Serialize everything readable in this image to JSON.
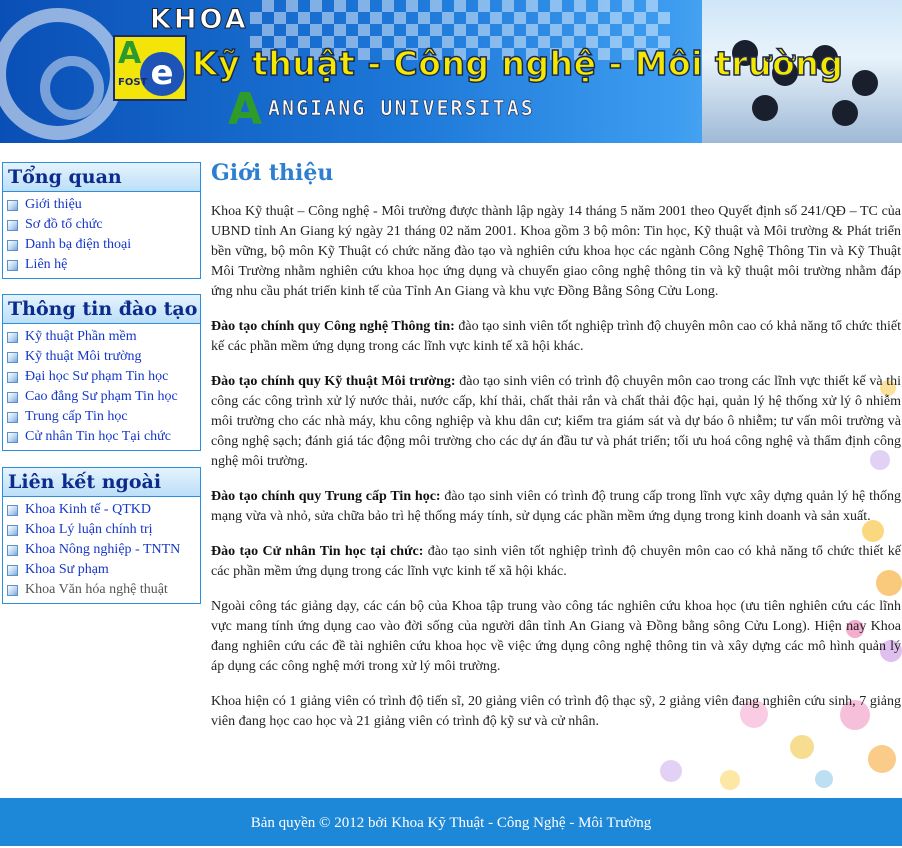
{
  "banner": {
    "khoa_text": "KHOA",
    "dept_name": "Kỹ thuật - Công nghệ - Môi trường",
    "university": "ANGIANG UNIVERSITAS",
    "logo_letter_a": "A",
    "logo_letter_e": "e",
    "logo_fost": "FOST"
  },
  "sidebar": {
    "sections": [
      {
        "title": "Tổng quan",
        "items": [
          "Giới thiệu",
          "Sơ đồ tổ chức",
          "Danh bạ điện thoại",
          "Liên hệ"
        ]
      },
      {
        "title": "Thông tin đào tạo",
        "items": [
          "Kỹ thuật Phần mềm",
          "Kỹ thuật Môi trường",
          "Đại học Sư phạm Tin học",
          "Cao đẳng Sư phạm Tin học",
          "Trung cấp Tin học",
          "Cử nhân Tin học Tại chức"
        ]
      },
      {
        "title": "Liên kết ngoài",
        "items": [
          "Khoa Kinh tế - QTKD",
          "Khoa Lý luận chính trị",
          "Khoa Nông nghiệp - TNTN",
          "Khoa Sư phạm",
          "Khoa Văn hóa nghệ thuật"
        ]
      }
    ]
  },
  "main": {
    "title": "Giới thiệu",
    "intro": "Khoa Kỹ thuật – Công nghệ - Môi trường được thành lập ngày 14 tháng 5 năm 2001 theo Quyết định số 241/QĐ – TC của UBND tỉnh An Giang ký ngày 21 tháng 02 năm 2001. Khoa gồm 3 bộ môn: Tin học, Kỹ thuật và Môi trường & Phát triển bền vững, bộ môn Kỹ Thuật có chức năng đào tạo và nghiên cứu khoa học các ngành Công Nghệ Thông Tin và Kỹ Thuật Môi Trường nhằm nghiên cứu khoa học ứng dụng và chuyển giao công nghệ thông tin và kỹ thuật môi trường nhằm đáp ứng nhu cầu phát triển kinh tế của Tỉnh An Giang và khu vực Đồng Bằng Sông Cửu Long.",
    "programs": [
      {
        "label": "Đào tạo chính quy Công nghệ Thông tin:",
        "text": " đào tạo sinh viên tốt nghiệp trình độ chuyên môn cao có khả năng tổ chức thiết kế các phần mềm ứng dụng trong các lĩnh vực kinh tế xã hội khác."
      },
      {
        "label": "Đào tạo chính quy Kỹ thuật Môi trường:",
        "text": " đào tạo sinh viên có trình độ chuyên môn cao trong các lĩnh vực thiết kế và thi công các công trình xử lý nước thải, nước cấp, khí thải, chất thải rắn và chất thải độc hại, quản lý hệ thống xử lý ô nhiễm môi trường cho các nhà máy, khu công nghiệp và khu dân cư; kiểm tra giám sát và dự báo ô nhiễm; tư vấn môi trường và công nghệ sạch; đánh giá tác động môi trường cho các dự án đầu tư và phát triển; tối ưu hoá công nghệ và thẩm định công nghệ môi trường."
      },
      {
        "label": "Đào tạo chính quy Trung cấp Tin học:",
        "text": " đào tạo sinh viên có trình độ trung cấp trong lĩnh vực xây dựng quản lý hệ thống mạng vừa và nhỏ, sửa chữa bảo trì hệ thống máy tính, sử dụng các phần mềm ứng dụng trong kinh doanh và sản xuất."
      },
      {
        "label": "Đào tạo Cử nhân Tin học tại chức:",
        "text": " đào tạo sinh viên tốt nghiệp trình độ chuyên môn cao có khả năng tổ chức thiết kế các phần mềm ứng dụng trong các lĩnh vực kinh tế xã hội khác."
      }
    ],
    "research": "Ngoài công tác giảng dạy, các cán bộ của Khoa tập trung vào công tác nghiên cứu khoa học (ưu tiên nghiên cứu các lĩnh vực mang tính ứng dụng cao vào đời sống của người dân tỉnh An Giang và Đồng bằng sông Cửu Long). Hiện nay Khoa đang nghiên cứu các đề tài nghiên cứu khoa học về việc ứng dụng công nghệ thông tin và xây dựng các mô hình quản lý áp dụng các công nghệ mới trong xử lý môi trường.",
    "staff": "Khoa hiện có 1 giảng viên có trình độ tiến sĩ, 20 giảng viên có trình độ thạc sỹ, 2 giảng viên đang nghiên cứu sinh, 7 giảng viên đang học cao học và 21 giảng viên có trình độ kỹ sư và cử nhân."
  },
  "footer": {
    "copyright": "Bản quyền © 2012 bởi Khoa Kỹ Thuật - Công Nghệ - Môi Trường"
  },
  "colors": {
    "accent": "#1e88d8",
    "sidebar_link": "#1436c8",
    "sidebar_title": "#0b2c8c",
    "title": "#2e7fd1"
  }
}
